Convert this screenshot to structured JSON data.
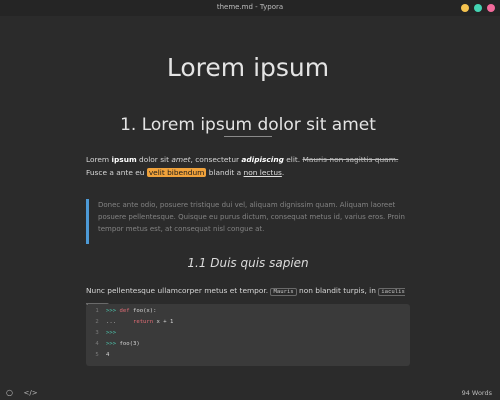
{
  "window": {
    "title": "theme.md - Typora"
  },
  "document": {
    "h1": "Lorem ipsum",
    "h2": "1. Lorem ipsum dolor sit amet",
    "p1": {
      "t1": "Lorem ",
      "b1": "ipsum",
      "t2": " dolor sit ",
      "i1": "amet",
      "t3": ", consectetur ",
      "bi1": "adipiscing",
      "t4": " elit. ",
      "s1": "Mauris non sagittis quam.",
      "t5": " Fusce a ante eu ",
      "mark1": "velit bibendum",
      "t6": " blandit a ",
      "u1": "non lectus",
      "t7": "."
    },
    "quote": "Donec ante odio, posuere tristique dui vel, aliquam dignissim quam. Aliquam laoreet posuere pellentesque. Quisque eu purus dictum, consequat metus id, varius eros. Proin tempor metus est, at consequat nisl congue at.",
    "h3": "1.1 Duis quis sapien",
    "p2": {
      "t1": "Nunc pellentesque ullamcorper metus et tempor. ",
      "code1": "Mauris",
      "t2": " non blandit turpis, in ",
      "code2": "iaculis libero",
      "t3": "."
    },
    "codeblock": [
      {
        "n": "1",
        "prompt": ">>>",
        "kw": "def",
        "rest": " foo(x):"
      },
      {
        "n": "2",
        "prompt": "...",
        "kw": "    return",
        "rest": " x + 1"
      },
      {
        "n": "3",
        "prompt": ">>>",
        "kw": "",
        "rest": ""
      },
      {
        "n": "4",
        "prompt": ">>>",
        "kw": "",
        "rest": " foo(3)"
      },
      {
        "n": "5",
        "prompt": "4",
        "kw": "",
        "rest": ""
      }
    ]
  },
  "status": {
    "word_count": "94 Words",
    "left_icons": [
      "circle-icon",
      "source-code-icon"
    ]
  },
  "colors": {
    "highlight": "#f0a23b",
    "quote_bar": "#4d9ad6",
    "min": "#f5c34f",
    "max": "#44d4b3",
    "close": "#f36a9b"
  }
}
